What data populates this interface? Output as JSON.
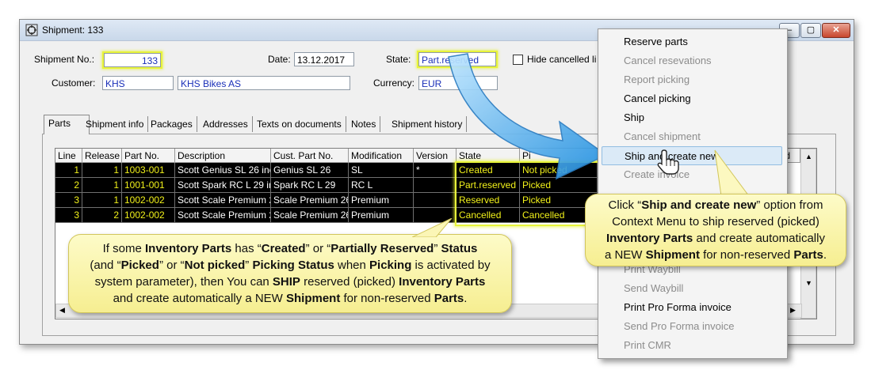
{
  "window": {
    "title": "Shipment: 133",
    "controls": {
      "minimize": "–",
      "maximize": "▢",
      "close": "✕"
    }
  },
  "header": {
    "shipment_no_label": "Shipment No.:",
    "shipment_no": "133",
    "date_label": "Date:",
    "date": "13.12.2017",
    "state_label": "State:",
    "state": "Part.reserved",
    "hide_cancelled_label": "Hide cancelled li",
    "customer_label": "Customer:",
    "customer_code": "KHS",
    "customer_name": "KHS Bikes AS",
    "currency_label": "Currency:",
    "currency": "EUR"
  },
  "tabs": [
    {
      "label": "Parts"
    },
    {
      "label": "Shipment info"
    },
    {
      "label": "Packages"
    },
    {
      "label": "Addresses"
    },
    {
      "label": "Texts on documents"
    },
    {
      "label": "Notes"
    },
    {
      "label": "Shipment history"
    }
  ],
  "grid": {
    "columns": [
      "Line",
      "Release",
      "Part No.",
      "Description",
      "Cust. Part No.",
      "Modification",
      "Version",
      "State",
      "Pi",
      "ered"
    ],
    "rows": [
      {
        "line": "1",
        "release": "1",
        "part_no": "1003-001",
        "description": "Scott Genius SL 26 inc",
        "cust_part_no": "Genius SL 26",
        "modification": "SL",
        "version": "*",
        "state": "Created",
        "picking": "Not picked"
      },
      {
        "line": "2",
        "release": "1",
        "part_no": "1001-001",
        "description": "Scott Spark RC L 29 ir",
        "cust_part_no": "Spark RC L 29",
        "modification": "RC L",
        "version": "",
        "state": "Part.reserved",
        "picking": "Picked"
      },
      {
        "line": "3",
        "release": "1",
        "part_no": "1002-002",
        "description": "Scott Scale Premium 2",
        "cust_part_no": "Scale Premium 26",
        "modification": "Premium",
        "version": "",
        "state": "Reserved",
        "picking": "Picked"
      },
      {
        "line": "3",
        "release": "2",
        "part_no": "1002-002",
        "description": "Scott Scale Premium 2",
        "cust_part_no": "Scale Premium 26",
        "modification": "Premium",
        "version": "",
        "state": "Cancelled",
        "picking": "Cancelled"
      }
    ]
  },
  "context_menu": {
    "items": [
      {
        "label": "Reserve parts",
        "enabled": true
      },
      {
        "label": "Cancel resevations",
        "enabled": false
      },
      {
        "label": "Report picking",
        "enabled": false
      },
      {
        "label": "Cancel picking",
        "enabled": true
      },
      {
        "label": "Ship",
        "enabled": true
      },
      {
        "label": "Cancel shipment",
        "enabled": false
      },
      {
        "label": "Ship and create new",
        "enabled": true,
        "selected": true
      },
      {
        "label": "Create invoice",
        "enabled": false
      },
      {
        "label": "Print Waybill",
        "enabled": false
      },
      {
        "label": "Send Waybill",
        "enabled": false
      },
      {
        "label": "Print Pro Forma invoice",
        "enabled": true
      },
      {
        "label": "Send Pro Forma invoice",
        "enabled": false
      },
      {
        "label": "Print CMR",
        "enabled": false
      }
    ]
  },
  "callout_left": {
    "l1a": "If some ",
    "l1b": "Inventory Parts",
    "l1c": " has “",
    "l1d": "Created",
    "l1e": "” or “",
    "l1f": "Partially Reserved",
    "l1g": "” ",
    "l1h": "Status",
    "l2a": "(and “",
    "l2b": "Picked",
    "l2c": "” or “",
    "l2d": "Not picked",
    "l2e": "” ",
    "l2f": "Picking Status",
    "l2g": " when ",
    "l2h": "Picking",
    "l2i": " is activated by",
    "l3a": "system parameter), then You can ",
    "l3b": "SHIP",
    "l3c": " reserved (picked) ",
    "l3d": "Inventory Parts",
    "l4a": "and create automatically a NEW ",
    "l4b": "Shipment",
    "l4c": " for non-reserved ",
    "l4d": "Parts",
    "l4e": "."
  },
  "callout_right": {
    "l1a": "Click “",
    "l1b": "Ship and create new",
    "l1c": "” option from",
    "l2": "Context Menu to ship reserved (picked)",
    "l3a": "Inventory Parts",
    "l3b": " and create automatically",
    "l4a": "a NEW ",
    "l4b": "Shipment",
    "l4c": " for non-reserved ",
    "l4d": "Parts",
    "l4e": "."
  },
  "colors": {
    "highlight": "#e8f43a",
    "field_text": "#1a2fb8",
    "callout_bg": "#f6ee91",
    "arrow": "#1f8fe0",
    "menu_selected": "#dbeaf7"
  },
  "icons": [
    "window-app-icon",
    "hand-cursor-icon",
    "checkbox-icon",
    "scroll-up-icon",
    "scroll-down-icon",
    "scroll-left-icon",
    "scroll-right-icon"
  ]
}
